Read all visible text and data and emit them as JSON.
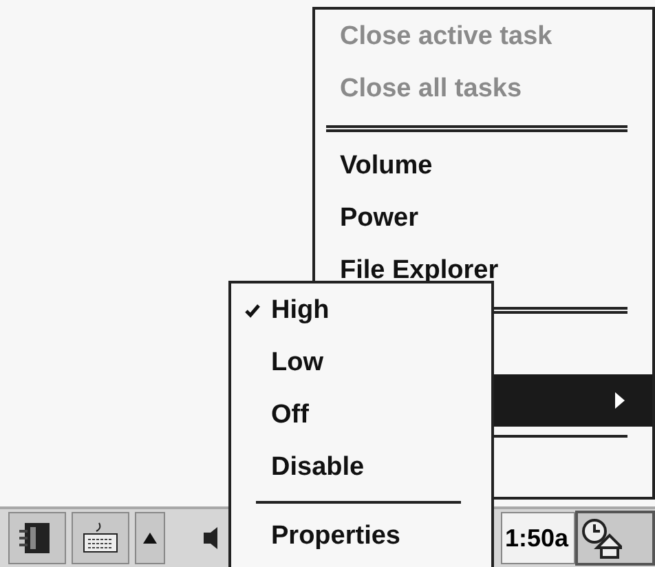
{
  "start_menu": {
    "items": [
      {
        "kind": "item",
        "label": "Close active task",
        "disabled": true,
        "selected": false
      },
      {
        "kind": "item",
        "label": "Close all tasks",
        "disabled": true,
        "selected": false
      },
      {
        "kind": "separator"
      },
      {
        "kind": "item",
        "label": "Volume",
        "disabled": false,
        "selected": false
      },
      {
        "kind": "item",
        "label": "Power",
        "disabled": false,
        "selected": false
      },
      {
        "kind": "item",
        "label": "File Explorer",
        "disabled": false,
        "selected": false
      },
      {
        "kind": "separator"
      },
      {
        "kind": "covered",
        "selected": false,
        "submenu": false
      },
      {
        "kind": "covered",
        "selected": true,
        "submenu": true
      },
      {
        "kind": "thin_separator"
      },
      {
        "kind": "covered",
        "selected": false,
        "submenu": false
      }
    ]
  },
  "submenu": {
    "items": [
      {
        "kind": "item",
        "label": "High",
        "checked": true
      },
      {
        "kind": "item",
        "label": "Low",
        "checked": false
      },
      {
        "kind": "item",
        "label": "Off",
        "checked": false
      },
      {
        "kind": "item",
        "label": "Disable",
        "checked": false
      },
      {
        "kind": "separator"
      },
      {
        "kind": "item",
        "label": "Properties",
        "checked": false
      }
    ]
  },
  "taskbar": {
    "clock": "1:50a"
  }
}
